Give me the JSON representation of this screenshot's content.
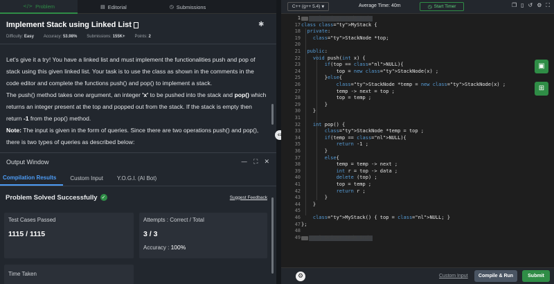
{
  "left_tabs": [
    {
      "icon": "</>",
      "label": "Problem"
    },
    {
      "icon": "▤",
      "label": "Editorial"
    },
    {
      "icon": "◷",
      "label": "Submissions"
    }
  ],
  "problem": {
    "title": "Implement Stack using Linked List",
    "meta": {
      "difficulty_label": "Difficulty:",
      "difficulty": "Easy",
      "accuracy_label": "Accuracy:",
      "accuracy": "53.98%",
      "submissions_label": "Submissions:",
      "submissions": "155K+",
      "points_label": "Points:",
      "points": "2"
    },
    "p1": "Let's give it a try! You have a linked list and must implement the functionalities push and pop of stack using this given linked list. Your task is to use the class as shown in the comments in the code editor and complete the functions push() and pop() to implement a stack.",
    "p2_a": "The push() method takes one argument, an integer ",
    "p2_b": "'x'",
    "p2_c": " to be pushed into the stack and ",
    "p2_d": "pop()",
    "p2_e": " which returns an integer present at the top and popped out from the stack. If the stack is empty then return ",
    "p2_f": "-1",
    "p2_g": " from the pop() method.",
    "p3_a": "Note:",
    "p3_b": " The input is given in the form of queries. Since there are two operations push() and pop(), there is two types of queries as described below:"
  },
  "output": {
    "title": "Output Window",
    "controls": {
      "minimize": "—",
      "expand": "⛶",
      "close": "✕"
    },
    "tabs": [
      "Compilation Results",
      "Custom Input",
      "Y.O.G.I. (AI Bot)"
    ],
    "status": "Problem Solved Successfully",
    "suggest_feedback": "Suggest Feedback",
    "test_cases_label": "Test Cases Passed",
    "test_cases_value": "1115 / 1115",
    "attempts_label": "Attempts : Correct / Total",
    "attempts_value": "3 / 3",
    "accuracy_label": "Accuracy :",
    "accuracy_value": "100%",
    "time_taken_label": "Time Taken"
  },
  "editor_bar": {
    "language": "C++ (g++ 5.4)",
    "avg_time_label": "Average Time:",
    "avg_time": "40m",
    "timer_label": "Start Timer"
  },
  "code_lines": [
    {
      "n": "1",
      "fold": true,
      "text": "// } Driver Code Ends"
    },
    {
      "n": "17",
      "text": "class MyStack {"
    },
    {
      "n": "18",
      "text": "  private:"
    },
    {
      "n": "19",
      "text": "    StackNode *top;"
    },
    {
      "n": "20",
      "text": ""
    },
    {
      "n": "21",
      "text": "  public:"
    },
    {
      "n": "22",
      "text": "    void push(int x) {"
    },
    {
      "n": "23",
      "text": "        if(top == NULL){"
    },
    {
      "n": "24",
      "text": "            top = new StackNode(x) ;"
    },
    {
      "n": "25",
      "text": "        }else{"
    },
    {
      "n": "26",
      "text": "            StackNode *temp = new StackNode(x) ;"
    },
    {
      "n": "27",
      "text": "            temp -> next = top ;"
    },
    {
      "n": "28",
      "text": "            top = temp ;"
    },
    {
      "n": "29",
      "text": "        }"
    },
    {
      "n": "30",
      "text": "    }"
    },
    {
      "n": "31",
      "text": ""
    },
    {
      "n": "32",
      "text": "    int pop() {"
    },
    {
      "n": "33",
      "text": "        StackNode *temp = top ;"
    },
    {
      "n": "34",
      "text": "        if(temp == NULL){"
    },
    {
      "n": "35",
      "text": "            return -1 ;"
    },
    {
      "n": "36",
      "text": "        }"
    },
    {
      "n": "37",
      "text": "        else{"
    },
    {
      "n": "38",
      "text": "            temp = temp -> next ;"
    },
    {
      "n": "39",
      "text": "            int r = top -> data ;"
    },
    {
      "n": "40",
      "text": "            delete (top) ;"
    },
    {
      "n": "41",
      "text": "            top = temp ;"
    },
    {
      "n": "42",
      "text": "            return r ;"
    },
    {
      "n": "43",
      "text": "        }"
    },
    {
      "n": "44",
      "text": "    }"
    },
    {
      "n": "45",
      "text": ""
    },
    {
      "n": "46",
      "text": "    MyStack() { top = NULL; }"
    },
    {
      "n": "47",
      "text": "};"
    },
    {
      "n": "48",
      "text": ""
    },
    {
      "n": "49",
      "fold": true,
      "text": "// } Driver Code Ends"
    }
  ],
  "bottom_bar": {
    "custom_input": "Custom Input",
    "compile_run": "Compile & Run",
    "submit": "Submit"
  },
  "colors": {
    "accent_green": "#2f8d46",
    "accent_blue": "#4d9cf5",
    "keyword": "#569cd6",
    "type": "#4ec9b0"
  }
}
